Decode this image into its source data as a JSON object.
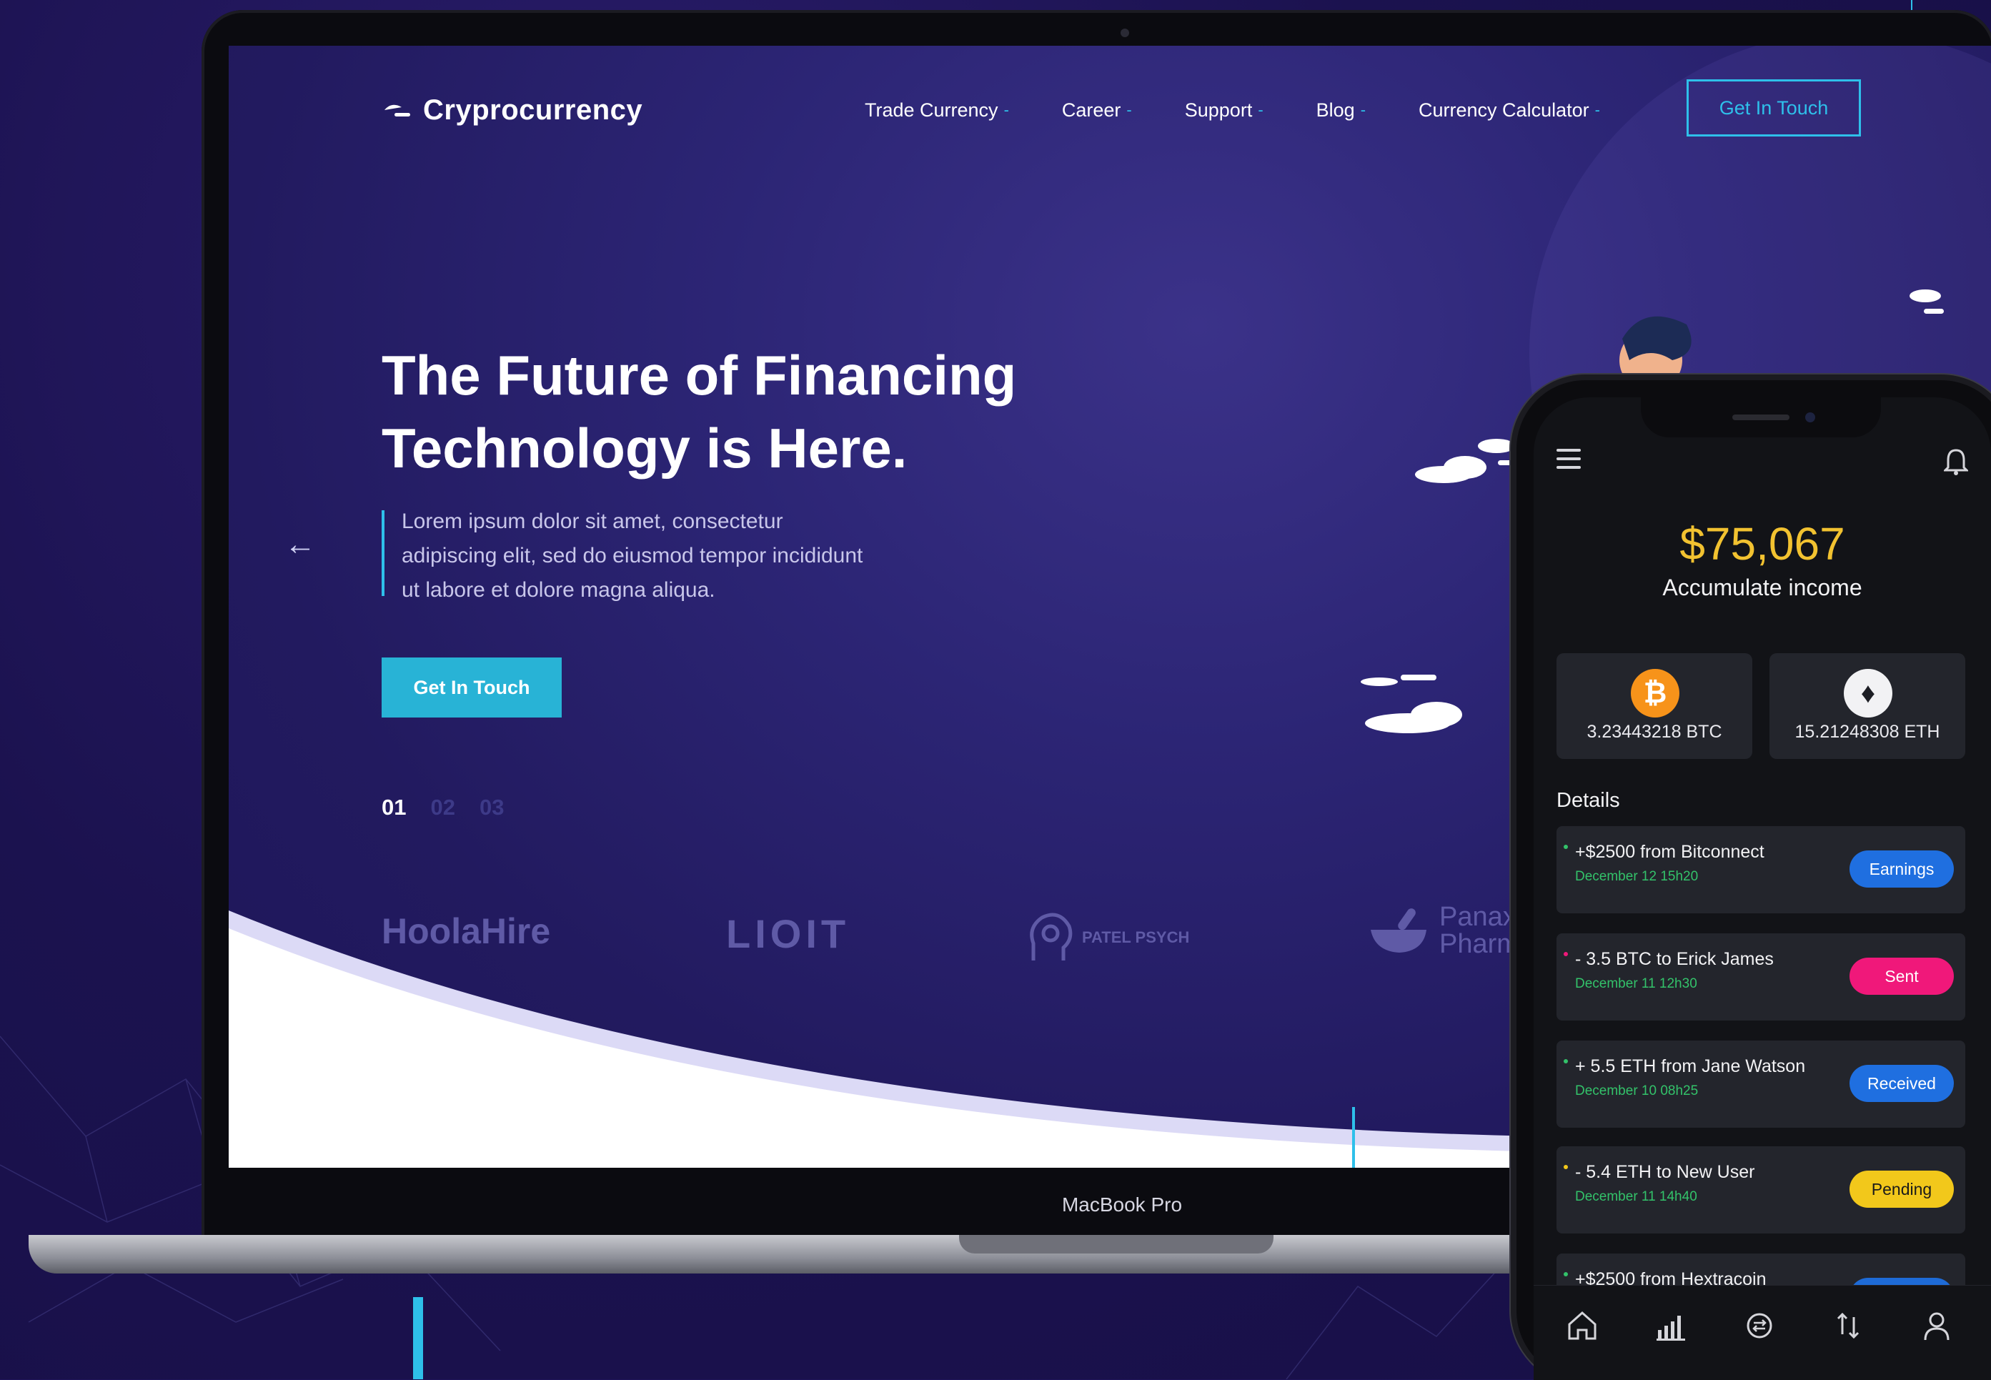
{
  "site": {
    "brand": "Cryprocurrency",
    "nav": [
      {
        "label": "Trade Currency",
        "dash": "-"
      },
      {
        "label": "Career",
        "dash": "-"
      },
      {
        "label": "Support",
        "dash": "-"
      },
      {
        "label": "Blog",
        "dash": "-"
      },
      {
        "label": "Currency Calculator",
        "dash": "-"
      }
    ],
    "nav_cta": "Get In Touch"
  },
  "hero": {
    "title_line1": "The Future of Financing",
    "title_line2": "Technology is Here.",
    "desc_line1": "Lorem ipsum dolor sit amet, consectetur",
    "desc_line2": "adipiscing elit, sed do eiusmod tempor incididunt",
    "desc_line3": "ut labore et dolore magna aliqua.",
    "cta": "Get In Touch",
    "prev_arrow": "←",
    "pager": [
      "01",
      "02",
      "03"
    ]
  },
  "partners": {
    "logo1": "HoolaHire",
    "logo2": "LIOIT",
    "logo3": "PATEL PSYCH",
    "logo4_line1": "Panax",
    "logo4_line2": "Pharma"
  },
  "laptop": {
    "label": "MacBook Pro"
  },
  "phone": {
    "balance": "$75,067",
    "balance_label": "Accumulate income",
    "coins": [
      {
        "symbol": "₿",
        "amount": "3.23443218 BTC"
      },
      {
        "symbol": "♦",
        "amount": "15.21248308 ETH"
      }
    ],
    "details_title": "Details",
    "transactions": [
      {
        "title": "+$2500 from Bitconnect",
        "date": "December 12 15h20",
        "status": "Earnings",
        "color": "#1f6fe0",
        "dot": "#33c26a"
      },
      {
        "title": "- 3.5 BTC to  Erick James",
        "date": "December 11 12h30",
        "status": "Sent",
        "color": "#f0187a",
        "dot": "#f0187a"
      },
      {
        "title": "+ 5.5 ETH from  Jane Watson",
        "date": "December 10 08h25",
        "status": "Received",
        "color": "#1f6fe0",
        "dot": "#33c26a"
      },
      {
        "title": "- 5.4 ETH to  New User",
        "date": "December 11 14h40",
        "status": "Pending",
        "color": "#f2c81b",
        "dot": "#f2c81b"
      },
      {
        "title": "+$2500 from Hextracoin",
        "date": "",
        "status": "",
        "color": "#1f6fe0",
        "dot": "#33c26a"
      }
    ],
    "tabs": [
      "home-icon",
      "chart-icon",
      "exchange-icon",
      "transfer-icon",
      "profile-icon"
    ]
  },
  "colors": {
    "accent": "#2ec0ea",
    "background": "#1e1459",
    "balance": "#f2c230"
  }
}
